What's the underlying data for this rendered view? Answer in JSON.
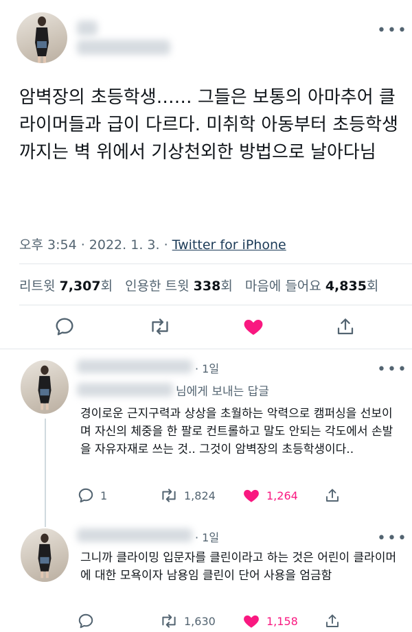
{
  "tweet": {
    "text": "암벽장의 초등학생…… 그들은 보통의 아마추어 클라이머들과 급이 다르다. 미취학 아동부터 초등학생까지는 벽 위에서 기상천외한 방법으로 날아다님",
    "time": "오후 3:54",
    "date": "2022. 1. 3.",
    "source": "Twitter for iPhone",
    "stats": {
      "retweets_label": "리트윗",
      "retweets": "7,307",
      "retweets_unit": "회",
      "quotes_label": "인용한 트윗",
      "quotes": "338",
      "quotes_unit": "회",
      "likes_label": "마음에 들어요",
      "likes": "4,835",
      "likes_unit": "회"
    }
  },
  "replies": [
    {
      "time": "· 1일",
      "reply_to": "님에게 보내는 답글",
      "text": "경이로운 근지구력과 상상을 초월하는 악력으로 캠퍼싱을 선보이며 자신의 체중을 한 팔로 컨트롤하고 말도 안되는 각도에서 손발을 자유자재로 쓰는 것.. 그것이 암벽장의 초등학생이다..",
      "replies": "1",
      "retweets": "1,824",
      "likes": "1,264"
    },
    {
      "time": "· 1일",
      "text": "그니까 클라이밍 입문자를 클린이라고 하는 것은 어린이 클라이머에 대한 모욕이자 남용임 클린이 단어 사용을 엄금함",
      "retweets": "1,630",
      "likes": "1,158"
    }
  ],
  "colors": {
    "like": "#f91880",
    "muted": "#536471",
    "text": "#0f1419"
  }
}
